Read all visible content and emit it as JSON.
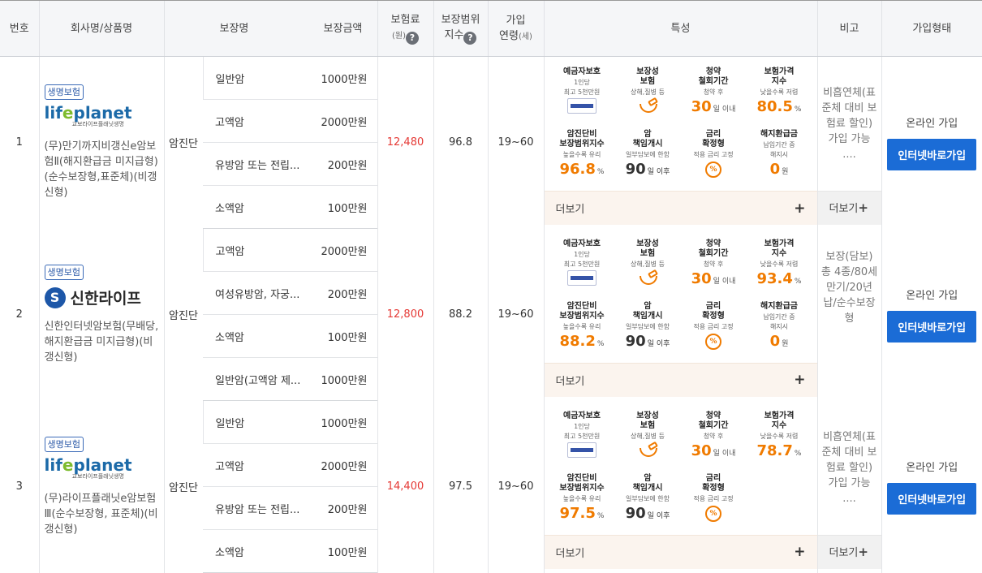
{
  "headers": {
    "no": "번호",
    "company": "회사명/상품명",
    "coverage": "보장명",
    "amount": "보장금액",
    "premium": "보험료",
    "premium_unit": "(원)",
    "range_l1": "보장범위",
    "range_l2": "지수",
    "age_l1": "가입",
    "age_l2": "연령",
    "age_unit": "(세)",
    "feature": "특성",
    "memo": "비고",
    "join": "가입형태"
  },
  "feature_labels": {
    "deposit_t": "예금자보호",
    "deposit_s1": "1인당",
    "deposit_s2": "최고 5천만원",
    "guarantee_t1": "보장성",
    "guarantee_t2": "보험",
    "guarantee_s": "상해,질병 등",
    "withdraw_t1": "청약",
    "withdraw_t2": "철회기간",
    "withdraw_s": "청약 후",
    "withdraw_unit": "일 이내",
    "price_t1": "보험가격",
    "price_t2": "지수",
    "price_s": "낮을수록 저렴",
    "cancer_t1": "암진단비",
    "cancer_t2": "보장범위지수",
    "cancer_s": "높을수록 유리",
    "start_t1": "암",
    "start_t2": "책임개시",
    "start_s": "일부담보에 한함",
    "start_unit": "일 이후",
    "rate_t1": "금리",
    "rate_t2": "확정형",
    "rate_s": "적용 금리 고정",
    "refund_t": "해지환급금",
    "refund_s1": "납입기간 중",
    "refund_s2": "해지시",
    "refund_unit": "원",
    "pct_unit": "%",
    "more": "더보기",
    "plus": "+"
  },
  "rows": [
    {
      "no": "1",
      "tag": "생명보험",
      "logo_a": "lif",
      "logo_o": "e",
      "logo_b": "planet",
      "logo_sub": "교보라이프플래닛생명",
      "product": "(무)만기까지비갱신e암보험Ⅱ(해지환급금 미지급형)(순수보장형,표준체)(비갱신형)",
      "type": "암진단",
      "coverages": [
        {
          "name": "일반암",
          "amount": "1000만원"
        },
        {
          "name": "고액암",
          "amount": "2000만원"
        },
        {
          "name": "유방암 또는 전립...",
          "amount": "200만원"
        },
        {
          "name": "소액암",
          "amount": "100만원"
        }
      ],
      "premium": "12,480",
      "range": "96.8",
      "age": "19~60",
      "withdraw": "30",
      "price": "80.5",
      "cancer": "96.8",
      "start": "90",
      "refund": "0",
      "memo": "비흡연체(표준체 대비 보험료 할인) 가입 가능 ....",
      "memo_more": "더보기",
      "join_online": "온라인 가입",
      "join_btn": "인터넷바로가입"
    },
    {
      "no": "2",
      "tag": "생명보험",
      "logo_mark": "S",
      "logo_text": "신한라이프",
      "product": "신한인터넷암보험(무배당, 해지환급금 미지급형)(비갱신형)",
      "type": "암진단",
      "coverages": [
        {
          "name": "고액암",
          "amount": "2000만원"
        },
        {
          "name": "여성유방암, 자궁...",
          "amount": "200만원"
        },
        {
          "name": "소액암",
          "amount": "100만원"
        },
        {
          "name": "일반암(고액암 제...",
          "amount": "1000만원"
        }
      ],
      "premium": "12,800",
      "range": "88.2",
      "age": "19~60",
      "withdraw": "30",
      "price": "93.4",
      "cancer": "88.2",
      "start": "90",
      "refund": "0",
      "memo": "보장(담보) 총 4종/80세만기/20년납/순수보장형",
      "join_online": "온라인 가입",
      "join_btn": "인터넷바로가입"
    },
    {
      "no": "3",
      "tag": "생명보험",
      "logo_a": "lif",
      "logo_o": "e",
      "logo_b": "planet",
      "logo_sub": "교보라이프플래닛생명",
      "product": "(무)라이프플래닛e암보험Ⅲ(순수보장형, 표준체)(비갱신형)",
      "type": "암진단",
      "coverages": [
        {
          "name": "일반암",
          "amount": "1000만원"
        },
        {
          "name": "고액암",
          "amount": "2000만원"
        },
        {
          "name": "유방암 또는 전립...",
          "amount": "200만원"
        },
        {
          "name": "소액암",
          "amount": "100만원"
        }
      ],
      "premium": "14,400",
      "range": "97.5",
      "age": "19~60",
      "withdraw": "30",
      "price": "78.7",
      "cancer": "97.5",
      "start": "90",
      "memo": "비흡연체(표준체 대비 보험료 할인) 가입 가능 ....",
      "memo_more": "더보기",
      "join_online": "온라인 가입",
      "join_btn": "인터넷바로가입"
    }
  ],
  "colors": {
    "accent_orange": "#f07b00",
    "premium_red": "#e53935",
    "join_button_blue": "#1b6cd6",
    "tag_blue": "#2c5aa8"
  },
  "icons": {
    "kdic_badge": "deposit-protection-badge-icon",
    "bowl": "medicine-bowl-icon",
    "percent_circle": "percent-circle-icon",
    "help": "question-mark-icon"
  }
}
